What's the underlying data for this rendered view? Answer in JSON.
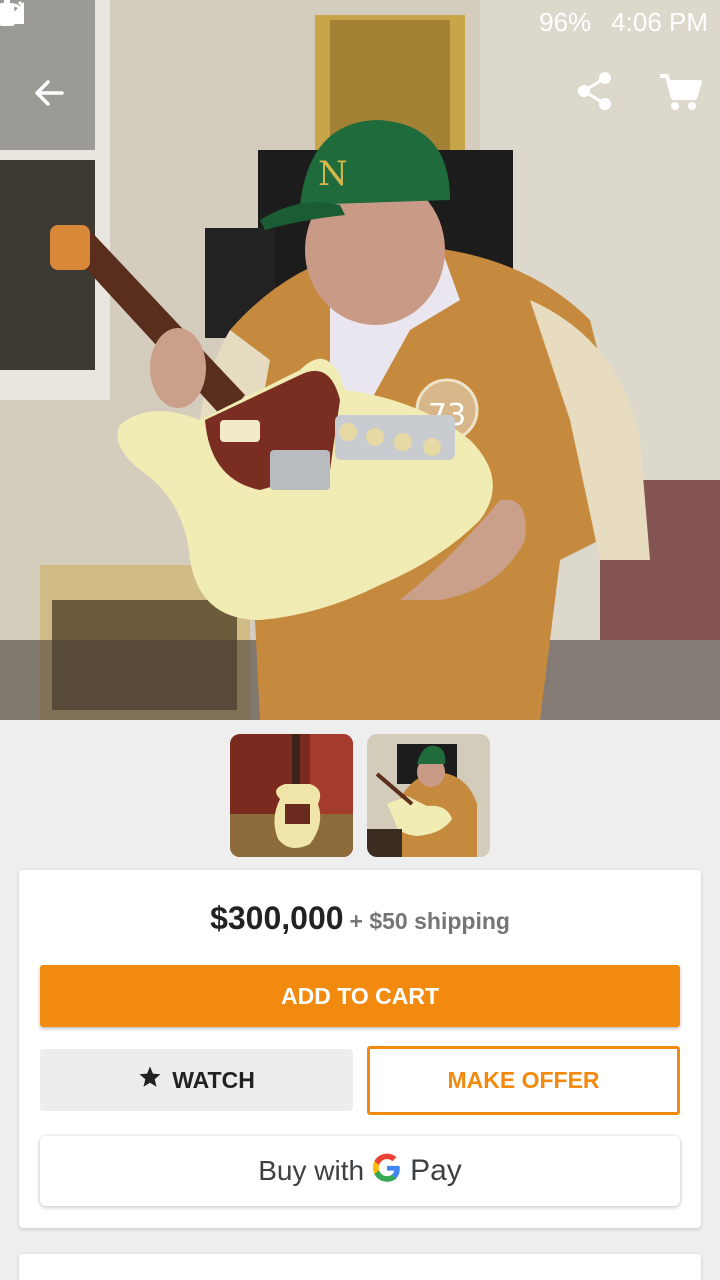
{
  "status_bar": {
    "battery": "96%",
    "time": "4:06 PM",
    "icons": [
      "alarm-icon",
      "data-icon",
      "signal-icon",
      "battery-icon"
    ]
  },
  "app_bar": {
    "icons": [
      "back-arrow-icon",
      "share-icon",
      "cart-icon"
    ]
  },
  "gallery": {
    "thumbnail_count": 2
  },
  "listing": {
    "price": "$300,000",
    "shipping": "+ $50 shipping",
    "add_to_cart_label": "ADD TO CART",
    "watch_label": "WATCH",
    "make_offer_label": "MAKE OFFER",
    "buy_with_label": "Buy with",
    "pay_label": "Pay"
  },
  "colors": {
    "accent_orange": "#f18a0f",
    "background": "#eeeeee"
  }
}
